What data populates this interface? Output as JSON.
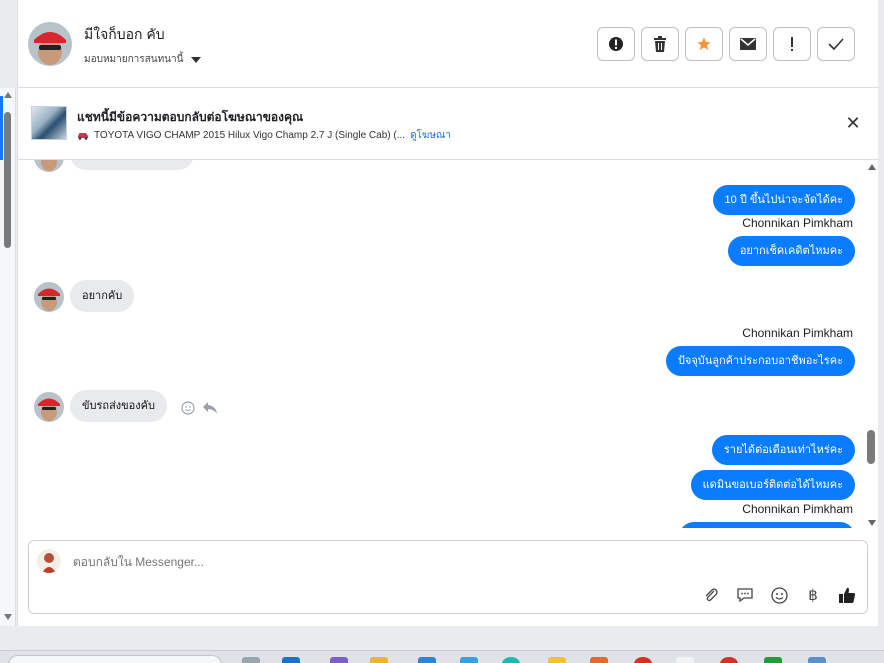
{
  "header": {
    "contact_name": "มีใจก็บอก คับ",
    "assign_label": "มอบหมายการสนทนานี้",
    "actions": [
      {
        "icon": "alert-circle-icon"
      },
      {
        "icon": "trash-icon"
      },
      {
        "icon": "star-icon"
      },
      {
        "icon": "envelope-icon"
      },
      {
        "icon": "exclamation-icon"
      },
      {
        "icon": "checkmark-icon"
      }
    ]
  },
  "ad": {
    "title": "แชทนี้มีข้อความตอบกลับต่อโฆษณาของคุณ",
    "product": "TOYOTA VIGO CHAMP 2015 Hilux Vigo Champ 2.7 J (Single Cab) (...",
    "link": "ดูโฆษณา"
  },
  "messages": {
    "out_1": "10 ปี ขึ้นไปน่าจะจัดได้คะ",
    "sender_1": "Chonnikan Pimkham",
    "out_2": "อยากเช็คเคดิตไหมคะ",
    "in_1": "อยากคับ",
    "sender_2": "Chonnikan Pimkham",
    "out_3": "ปัจจุบันลูกค้าประกอบอาชีพอะไรคะ",
    "in_2": "ขับรถส่งของคับ",
    "out_4": "รายได้ต่อเดือนเท่าไหร่คะ",
    "out_5": "แดมินขอเบอร์ติดต่อได้ไหมคะ",
    "sender_3": "Chonnikan Pimkham"
  },
  "composer": {
    "placeholder": "ตอบกลับใน Messenger...",
    "icons": [
      "paperclip-icon",
      "speech-bubble-icon",
      "emoji-icon",
      "baht-icon",
      "thumbs-up-icon"
    ],
    "baht_glyph": "฿"
  },
  "colors": {
    "accent": "#0a7cff",
    "incoming": "#e9eaec",
    "star": "#f7923b"
  }
}
